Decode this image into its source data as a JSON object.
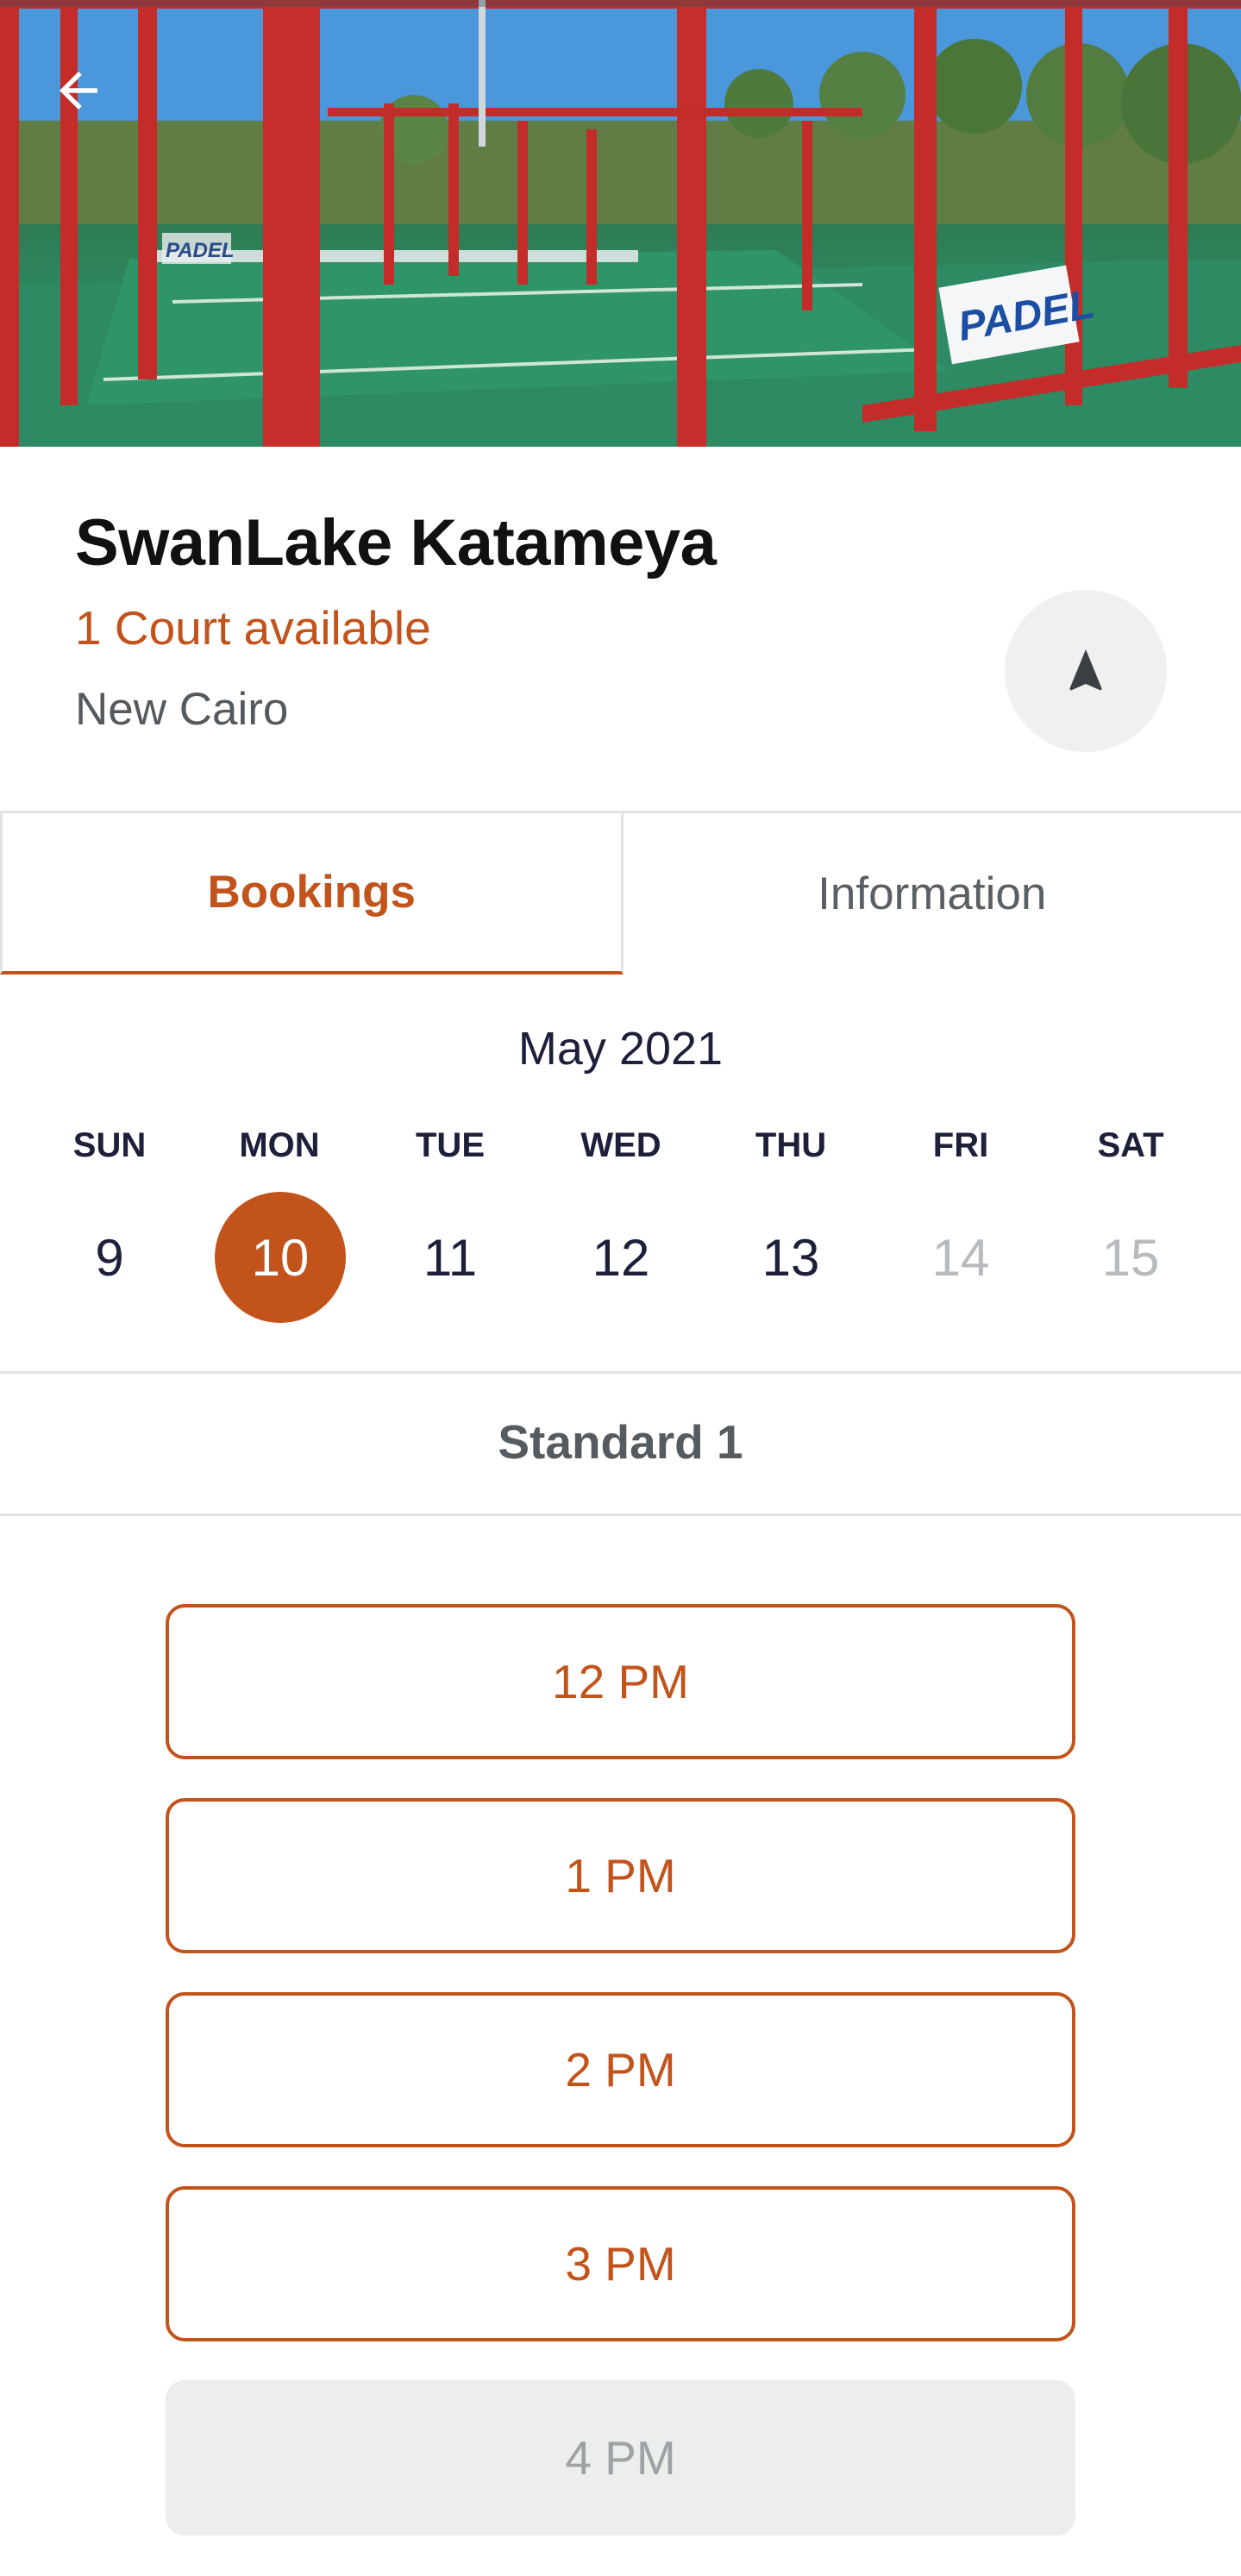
{
  "venue": {
    "name": "SwanLake Katameya",
    "availability": "1 Court available",
    "location": "New Cairo"
  },
  "tabs": [
    {
      "label": "Bookings",
      "active": true
    },
    {
      "label": "Information",
      "active": false
    }
  ],
  "calendar": {
    "month": "May 2021",
    "weekdays": [
      "SUN",
      "MON",
      "TUE",
      "WED",
      "THU",
      "FRI",
      "SAT"
    ],
    "days": [
      {
        "label": "9",
        "state": "available"
      },
      {
        "label": "10",
        "state": "selected"
      },
      {
        "label": "11",
        "state": "available"
      },
      {
        "label": "12",
        "state": "available"
      },
      {
        "label": "13",
        "state": "available"
      },
      {
        "label": "14",
        "state": "disabled"
      },
      {
        "label": "15",
        "state": "disabled"
      }
    ]
  },
  "court": {
    "name": "Standard 1"
  },
  "slots": [
    {
      "label": "12 PM",
      "available": true
    },
    {
      "label": "1 PM",
      "available": true
    },
    {
      "label": "2 PM",
      "available": true
    },
    {
      "label": "3 PM",
      "available": true
    },
    {
      "label": "4 PM",
      "available": false
    }
  ],
  "hero_signage": [
    "PADEL",
    "PADEL"
  ],
  "icons": {
    "back": "arrow-left-icon",
    "navigate": "navigation-arrow-icon"
  },
  "colors": {
    "accent": "#c2531b",
    "text_dark": "#1e1f3a",
    "muted": "#b8bbbd",
    "disabled_bg": "#eceded"
  }
}
